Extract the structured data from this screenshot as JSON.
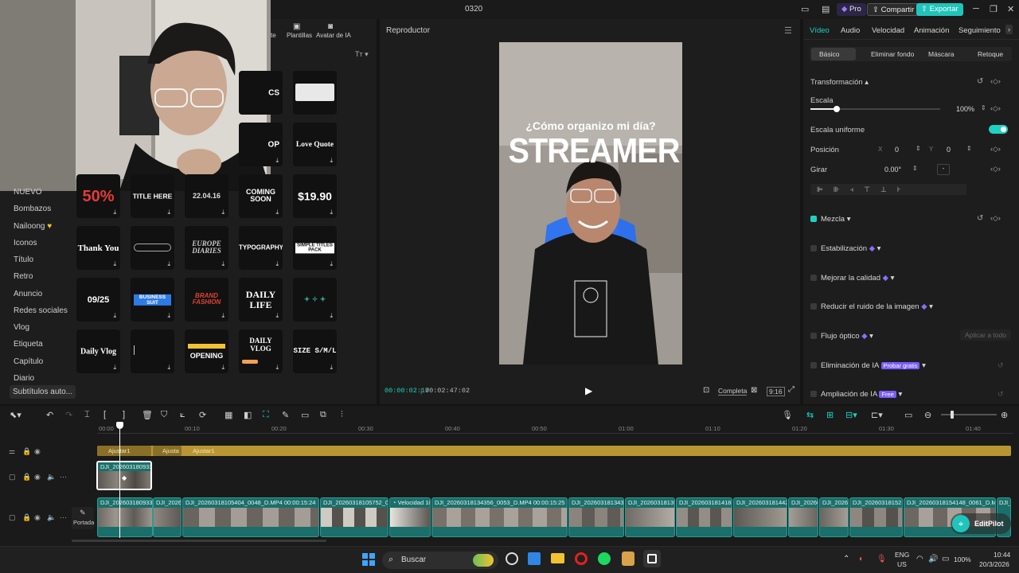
{
  "window": {
    "title": "0320",
    "pro_label": "Pro",
    "share_label": "Compartir",
    "export_label": "Exportar"
  },
  "toptabs": [
    "Texto",
    "Plantillas",
    "Avatar de IA"
  ],
  "categories": [
    "NUEVO",
    "Bombazos",
    "Nailoong",
    "Iconos",
    "Título",
    "Retro",
    "Anuncio",
    "Redes sociales",
    "Vlog",
    "Etiqueta",
    "Capítulo",
    "Diario",
    "Subtítulos auto..."
  ],
  "templates": [
    [
      "",
      "Love Quote",
      "",
      "",
      ""
    ],
    [
      "50%",
      "TITLE HERE",
      "22.04.16",
      "COMING SOON",
      "$19.90"
    ],
    [
      "Thank You",
      "",
      "EUROPE DIARIES",
      "TYPOGRAPHY",
      "SIMPLE TITLES PACK"
    ],
    [
      "09/25",
      "BUSINESS SUIT",
      "BRAND FASHION",
      "DAILY LIFE",
      ""
    ],
    [
      "Daily Vlog",
      "",
      "OPENING",
      "DAILY VLOG",
      "SIZE S/M/L"
    ]
  ],
  "player": {
    "title": "Reproductor",
    "current_time": "00:00:02:17",
    "total_time": "00:02:47:02",
    "quality_label": "Completa",
    "ratio_label": "9:16",
    "overlay_question": "¿Cómo organizo mi día?",
    "overlay_title": "STREAMER"
  },
  "inspector": {
    "tabs": [
      "Vídeo",
      "Audio",
      "Velocidad",
      "Animación",
      "Seguimiento"
    ],
    "subtabs": [
      "Básico",
      "Eliminar fondo",
      "Máscara",
      "Retoque"
    ],
    "section": "Transformación",
    "scale_label": "Escala",
    "scale_value": "100%",
    "scale_fraction": 1.0,
    "uniform_label": "Escala uniforme",
    "position_label": "Posición",
    "pos_x": "0",
    "pos_y": "0",
    "rotate_label": "Girar",
    "rotate_value": "0.00°",
    "blend_label": "Mezcla",
    "options": [
      "Estabilización",
      "Mejorar la calidad",
      "Reducir el ruido de la imagen",
      "Flujo óptico",
      "Eliminación de IA",
      "Ampliación de IA"
    ],
    "apply_all": "Aplicar a todo",
    "badge_try": "Probar gratis",
    "badge_free": "Free"
  },
  "timeline": {
    "ruler": [
      "00:00",
      "00:10",
      "00:20",
      "00:30",
      "00:40",
      "00:50",
      "01:00",
      "01:10",
      "01:20",
      "01:30",
      "01:40"
    ],
    "adjust_clips": [
      "Ajustar1",
      "Ajusta",
      "Ajustar1"
    ],
    "overlay_clip": "DJI_20260318093360",
    "cover_label": "Portada",
    "main_clips": [
      "DJI_20260318093360",
      "DJI_20260",
      "DJI_20260318105404_0048_D.MP4  00:00:15:24",
      "DJI_20260318105752_0048",
      "Velocidad 10",
      "DJI_20260318134356_0053_D.MP4  00:00:15:25",
      "DJI_20260318134358",
      "DJI_202603181354",
      "DJI_20260318141838",
      "DJI_20260318144244",
      "DJI_20260",
      "DJI_20260",
      "DJI_202603181521",
      "DJI_20260318154148_0061_D.MP4",
      "DJI_2026"
    ],
    "editpilot_label": "EditPilot"
  },
  "taskbar": {
    "search": "Buscar",
    "lang": "ENG",
    "region": "US",
    "battery": "100%",
    "time": "10:44",
    "date": "20/3/2026"
  },
  "colors": {
    "accent": "#1fd1c2",
    "adjust_track": "#b99633",
    "clip": "#1b6f6a",
    "pro": "#7a5cff"
  }
}
